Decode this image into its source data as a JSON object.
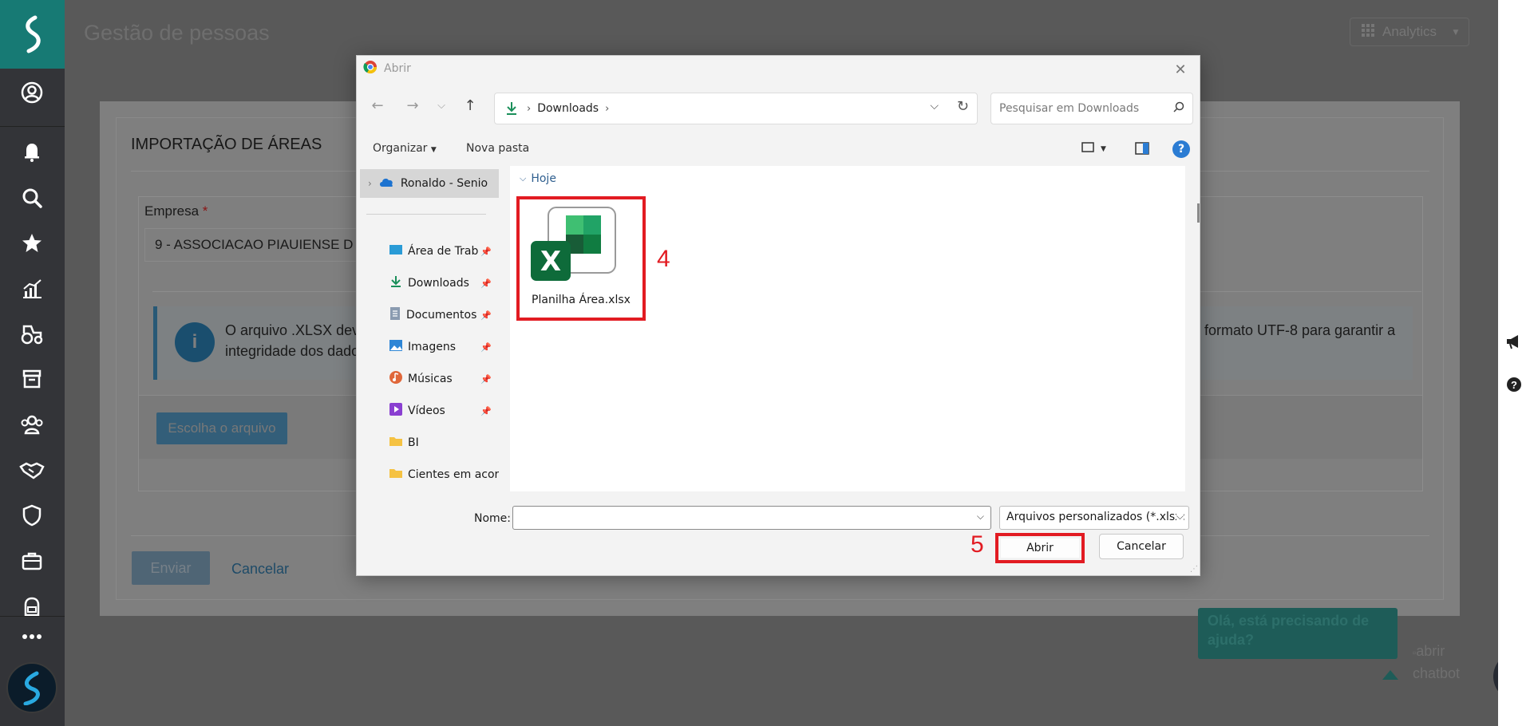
{
  "sidebar": {
    "items": [
      "logo",
      "user-circle",
      "bell",
      "search",
      "star",
      "chart",
      "tractor",
      "archive",
      "team",
      "handshake",
      "shield",
      "briefcase",
      "backpack",
      "more"
    ]
  },
  "app": {
    "title": "Gestão de pessoas",
    "analytics_label": "Analytics"
  },
  "modal": {
    "title": "IMPORTAÇÃO DE ÁREAS",
    "company_label": "Empresa",
    "required_mark": "*",
    "company_value": "9 - ASSOCIACAO PIAUIENSE D",
    "info_line1": "O arquivo .XLSX dev",
    "info_line2": "integridade dos dado",
    "info_line1_right": "formato UTF-8 para garantir a",
    "choose_file_label": "Escolha o arquivo",
    "send_label": "Enviar",
    "cancel_label": "Cancelar"
  },
  "chat": {
    "bubble_text": "Olá, está precisando de ajuda?",
    "alt_text_line1": "abrir",
    "alt_text_line2": "chatbot",
    "fab_icon": "⋮"
  },
  "dialog": {
    "title": "Abrir",
    "address_crumb": "Downloads",
    "search_placeholder": "Pesquisar em Downloads",
    "organize_label": "Organizar",
    "new_folder_label": "Nova pasta",
    "help_label": "?",
    "nav_top": "Ronaldo - Senio",
    "nav_items": [
      {
        "label": "Área de Trab",
        "icon": "desktop-icon",
        "pinned": true
      },
      {
        "label": "Downloads",
        "icon": "download-icon",
        "pinned": true
      },
      {
        "label": "Documentos",
        "icon": "document-icon",
        "pinned": true
      },
      {
        "label": "Imagens",
        "icon": "image-icon",
        "pinned": true
      },
      {
        "label": "Músicas",
        "icon": "music-icon",
        "pinned": true
      },
      {
        "label": "Vídeos",
        "icon": "video-icon",
        "pinned": true
      },
      {
        "label": "BI",
        "icon": "folder-icon",
        "pinned": false
      },
      {
        "label": "Cientes em acor",
        "icon": "folder-icon",
        "pinned": false
      }
    ],
    "group_header": "Hoje",
    "file_name": "Planilha Área.xlsx",
    "filename_label": "Nome:",
    "filename_value": "",
    "filetype_value": "Arquivos personalizados (*.xlsx;",
    "open_label": "Abrir",
    "cancel_label": "Cancelar"
  },
  "annotations": {
    "step4": "4",
    "step5": "5",
    "color": "#e21b22"
  }
}
